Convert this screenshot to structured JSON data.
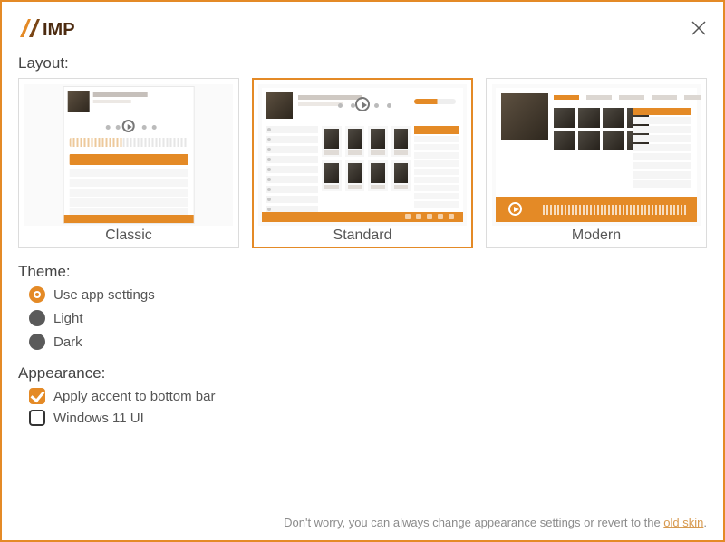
{
  "brand": "AIMP",
  "sections": {
    "layout_label": "Layout:",
    "theme_label": "Theme:",
    "appearance_label": "Appearance:"
  },
  "layouts": {
    "classic": "Classic",
    "standard": "Standard",
    "modern": "Modern",
    "selected": "standard"
  },
  "theme": {
    "options": {
      "use_app": "Use app settings",
      "light": "Light",
      "dark": "Dark"
    },
    "selected": "use_app"
  },
  "appearance": {
    "accent_bottom_bar": {
      "label": "Apply accent to bottom bar",
      "checked": true
    },
    "win11_ui": {
      "label": "Windows 11 UI",
      "checked": false
    }
  },
  "footer": {
    "text_before": "Don't worry, you can always change appearance settings or revert to the ",
    "link": "old skin",
    "text_after": "."
  },
  "colors": {
    "accent": "#e48a26"
  }
}
